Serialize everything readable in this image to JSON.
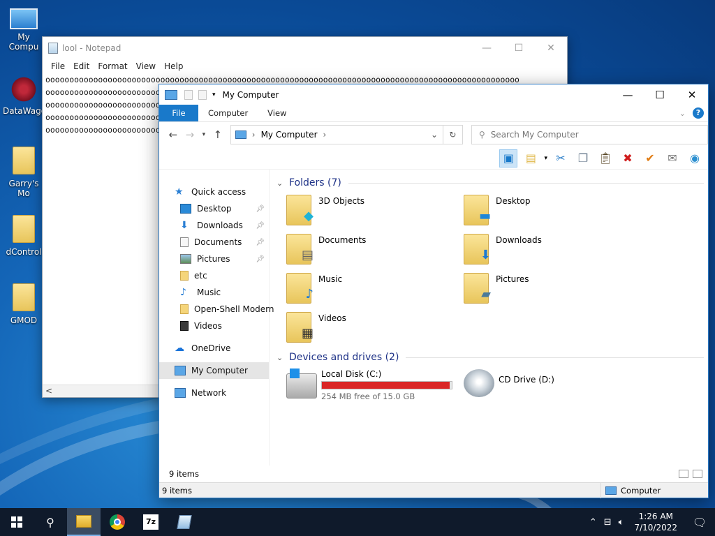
{
  "desktop": {
    "icons": [
      {
        "label": "My Compu",
        "icon": "computer-icon"
      },
      {
        "label": "DataWago",
        "icon": "datawagon-icon"
      },
      {
        "label": "Garry's Mo",
        "icon": "folder-icon"
      },
      {
        "label": "dControl",
        "icon": "folder-icon"
      },
      {
        "label": "GMOD",
        "icon": "folder-icon"
      }
    ]
  },
  "notepad": {
    "title": "lool - Notepad",
    "menu": [
      "File",
      "Edit",
      "Format",
      "View",
      "Help"
    ],
    "lines": [
      "ooooooooooooooooooooooooooooooooooooooooooooooooooooooooooooooooooooooooooooooooooooooooooooooooooo",
      "oooooooooooooooooooooooooooooooooooooooooooooooooooooooooooooooooooooooooooooooooooooooooooooooooo",
      "oooooooooooooooooooooooooooooooooooooooooooooooooooooooooooooooooooooooooooooooooooooooooooooooooo",
      "oooooooooooooooooooooooooooooooooooooooooooooooooooooooooooooooooooooooooooooooooooooooooooooooooo",
      "oooooooooooooooooooooooooooooooooooooooooooooooooooooooooooooooooooooooooooooooooooooooooooooooooo"
    ],
    "controls": {
      "minimize": "—",
      "maximize": "☐",
      "close": "✕"
    },
    "scroll_left": "<"
  },
  "explorer": {
    "title": "My Computer",
    "controls": {
      "minimize": "—",
      "maximize": "☐",
      "close": "✕"
    },
    "ribbon_tabs": [
      "File",
      "Computer",
      "View"
    ],
    "help_label": "?",
    "address": {
      "crumb": "My Computer",
      "sep": "›"
    },
    "search_placeholder": "Search My Computer",
    "nav": {
      "quick_access": "Quick access",
      "pinned": [
        {
          "label": "Desktop",
          "icon": "desktop-icon",
          "pinned": true
        },
        {
          "label": "Downloads",
          "icon": "download-icon",
          "pinned": true
        },
        {
          "label": "Documents",
          "icon": "document-icon",
          "pinned": true
        },
        {
          "label": "Pictures",
          "icon": "picture-icon",
          "pinned": true
        },
        {
          "label": "etc",
          "icon": "folder-icon",
          "pinned": false
        },
        {
          "label": "Music",
          "icon": "music-icon",
          "pinned": false
        },
        {
          "label": "Open-Shell Modern",
          "icon": "folder-icon",
          "pinned": false
        },
        {
          "label": "Videos",
          "icon": "video-icon",
          "pinned": false
        }
      ],
      "onedrive": "OneDrive",
      "this_pc": "My Computer",
      "network": "Network"
    },
    "folders_header": "Folders (7)",
    "folders": [
      {
        "label": "3D Objects",
        "overlay": "cube-icon"
      },
      {
        "label": "Desktop",
        "overlay": "desktop-icon"
      },
      {
        "label": "Documents",
        "overlay": "document-icon"
      },
      {
        "label": "Downloads",
        "overlay": "download-icon"
      },
      {
        "label": "Music",
        "overlay": "music-icon"
      },
      {
        "label": "Pictures",
        "overlay": "picture-icon"
      },
      {
        "label": "Videos",
        "overlay": "video-icon"
      }
    ],
    "drives_header": "Devices and drives (2)",
    "drives": [
      {
        "label": "Local Disk (C:)",
        "free": "254 MB free of 15.0 GB",
        "used_fraction": 0.983,
        "bar_color": "#da2626"
      },
      {
        "label": "CD Drive (D:)"
      }
    ],
    "status_items": "9 items",
    "statusbar": {
      "left": "9 items",
      "right": "Computer"
    }
  },
  "taskbar": {
    "clock_time": "1:26 AM",
    "clock_date": "7/10/2022",
    "sevenzip_label": "7z"
  },
  "colors": {
    "accent": "#1979ca",
    "group_header": "#1e3287",
    "taskbar": "#0f1a2b",
    "drive_bar": "#da2626"
  }
}
